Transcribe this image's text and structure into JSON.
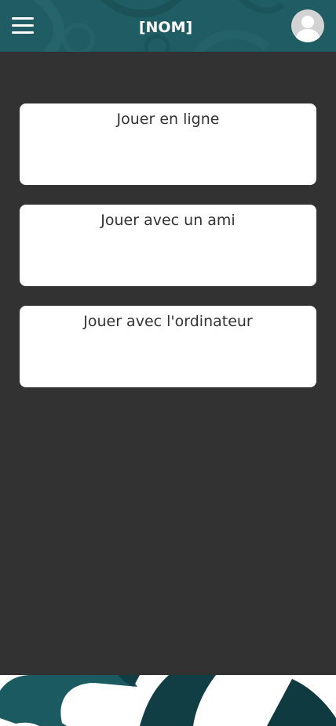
{
  "header": {
    "title": "[NOM]",
    "menu_icon": "hamburger-menu-icon",
    "avatar_icon": "user-avatar-icon"
  },
  "modes": [
    {
      "label": "Jouer en ligne"
    },
    {
      "label": "Jouer avec un ami"
    },
    {
      "label": "Jouer avec l'ordinateur"
    }
  ],
  "colors": {
    "header_bg": "#1f5c63",
    "main_bg": "#323232",
    "card_bg": "#ffffff",
    "accent": "#1c5a62"
  }
}
